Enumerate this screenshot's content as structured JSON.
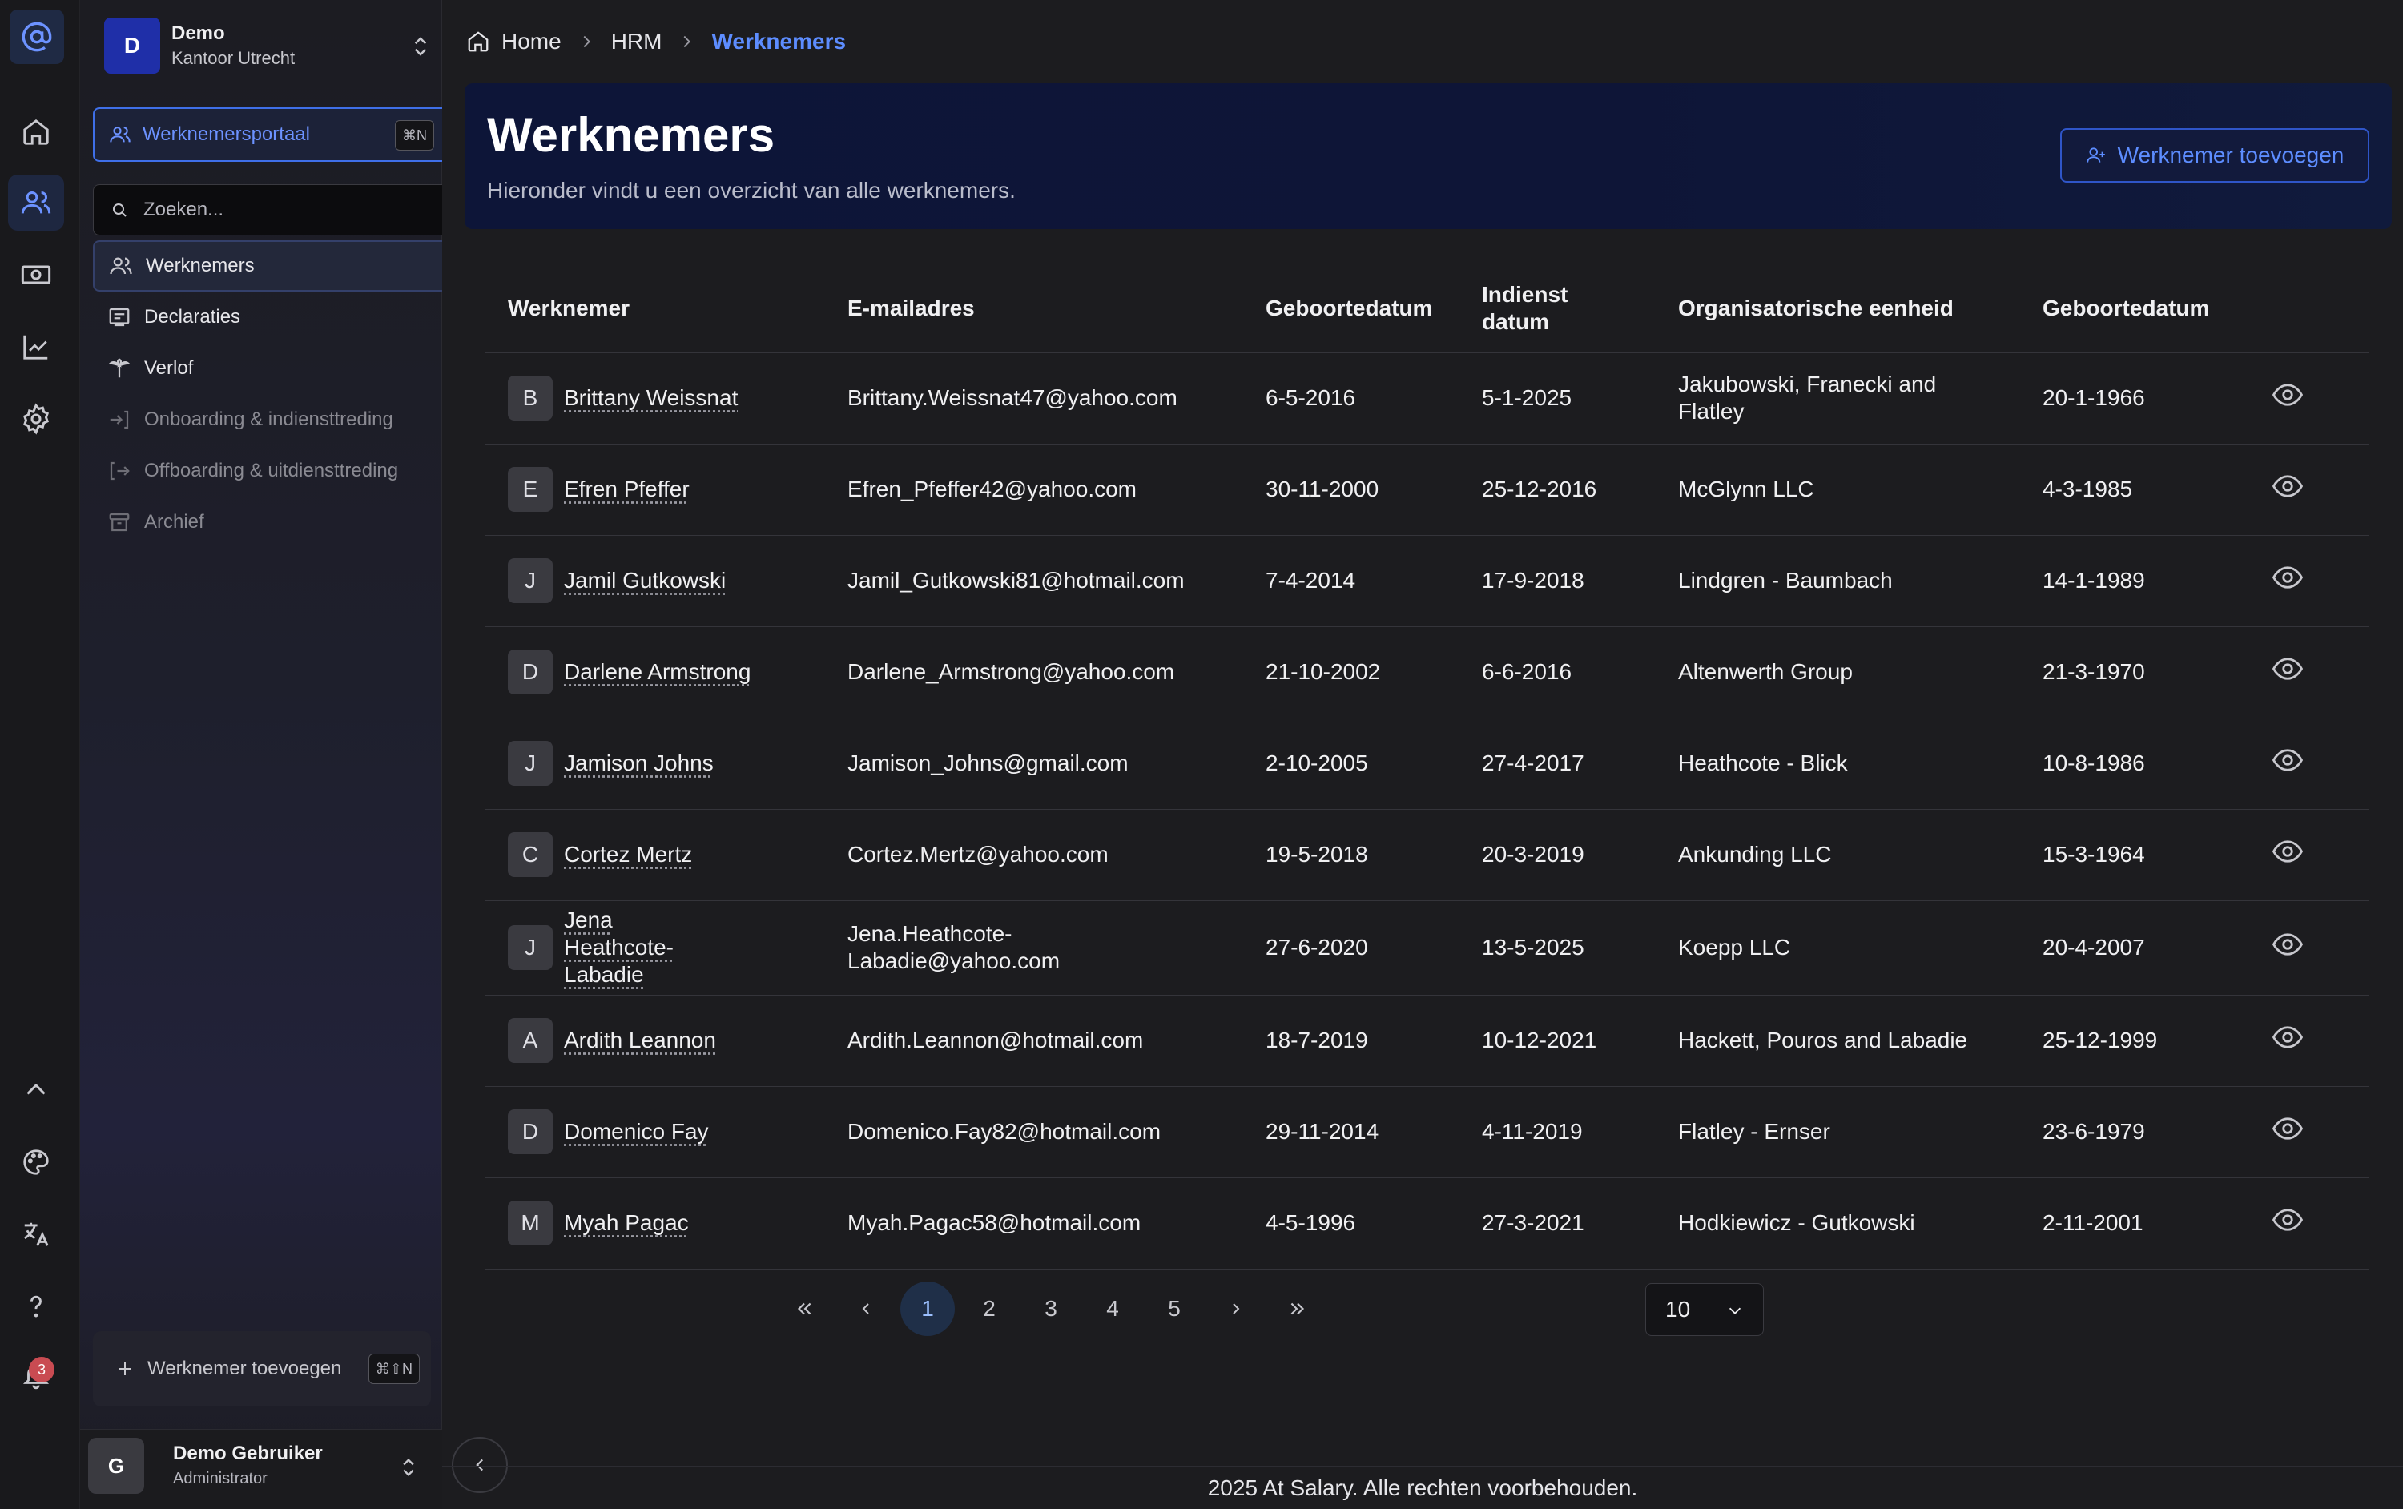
{
  "org": {
    "initial": "D",
    "name": "Demo",
    "location": "Kantoor Utrecht"
  },
  "portal": {
    "label": "Werknemersportaal",
    "shortcut": "⌘N"
  },
  "search": {
    "placeholder": "Zoeken..."
  },
  "nav": [
    {
      "label": "Werknemers",
      "icon": "users-icon",
      "state": "active"
    },
    {
      "label": "Declaraties",
      "icon": "receipt-icon",
      "state": "normal"
    },
    {
      "label": "Verlof",
      "icon": "palm-tree-icon",
      "state": "normal"
    },
    {
      "label": "Onboarding & indiensttreding",
      "icon": "login-icon",
      "state": "dim"
    },
    {
      "label": "Offboarding & uitdiensttreding",
      "icon": "logout-icon",
      "state": "dim"
    },
    {
      "label": "Archief",
      "icon": "archive-icon",
      "state": "dim"
    }
  ],
  "sidebar_add": {
    "label": "Werknemer toevoegen",
    "shortcut": "⌘⇧N"
  },
  "notifications": {
    "count": "3"
  },
  "user": {
    "initial": "G",
    "name": "Demo Gebruiker",
    "role": "Administrator"
  },
  "breadcrumb": {
    "home": "Home",
    "section": "HRM",
    "current": "Werknemers"
  },
  "header": {
    "title": "Werknemers",
    "subtitle": "Hieronder vindt u een overzicht van alle werknemers.",
    "add_button": "Werknemer toevoegen"
  },
  "table": {
    "columns": [
      "Werknemer",
      "E-mailadres",
      "Geboortedatum",
      "Indienst datum",
      "Organisatorische eenheid",
      "Geboortedatum"
    ],
    "rows": [
      {
        "initial": "B",
        "name": "Brittany Weissnat",
        "email": "Brittany.Weissnat47@yahoo.com",
        "birth": "6-5-2016",
        "start": "5-1-2025",
        "unit": "Jakubowski, Franecki and Flatley",
        "birth2": "20-1-1966"
      },
      {
        "initial": "E",
        "name": "Efren Pfeffer",
        "email": "Efren_Pfeffer42@yahoo.com",
        "birth": "30-11-2000",
        "start": "25-12-2016",
        "unit": "McGlynn LLC",
        "birth2": "4-3-1985"
      },
      {
        "initial": "J",
        "name": "Jamil Gutkowski",
        "email": "Jamil_Gutkowski81@hotmail.com",
        "birth": "7-4-2014",
        "start": "17-9-2018",
        "unit": "Lindgren - Baumbach",
        "birth2": "14-1-1989"
      },
      {
        "initial": "D",
        "name": "Darlene Armstrong",
        "email": "Darlene_Armstrong@yahoo.com",
        "birth": "21-10-2002",
        "start": "6-6-2016",
        "unit": "Altenwerth Group",
        "birth2": "21-3-1970"
      },
      {
        "initial": "J",
        "name": "Jamison Johns",
        "email": "Jamison_Johns@gmail.com",
        "birth": "2-10-2005",
        "start": "27-4-2017",
        "unit": "Heathcote - Blick",
        "birth2": "10-8-1986"
      },
      {
        "initial": "C",
        "name": "Cortez Mertz",
        "email": "Cortez.Mertz@yahoo.com",
        "birth": "19-5-2018",
        "start": "20-3-2019",
        "unit": "Ankunding LLC",
        "birth2": "15-3-1964"
      },
      {
        "initial": "J",
        "name": "Jena Heathcote-Labadie",
        "email": "Jena.Heathcote-Labadie@yahoo.com",
        "birth": "27-6-2020",
        "start": "13-5-2025",
        "unit": "Koepp LLC",
        "birth2": "20-4-2007"
      },
      {
        "initial": "A",
        "name": "Ardith Leannon",
        "email": "Ardith.Leannon@hotmail.com",
        "birth": "18-7-2019",
        "start": "10-12-2021",
        "unit": "Hackett, Pouros and Labadie",
        "birth2": "25-12-1999"
      },
      {
        "initial": "D",
        "name": "Domenico Fay",
        "email": "Domenico.Fay82@hotmail.com",
        "birth": "29-11-2014",
        "start": "4-11-2019",
        "unit": "Flatley - Ernser",
        "birth2": "23-6-1979"
      },
      {
        "initial": "M",
        "name": "Myah Pagac",
        "email": "Myah.Pagac58@hotmail.com",
        "birth": "4-5-1996",
        "start": "27-3-2021",
        "unit": "Hodkiewicz - Gutkowski",
        "birth2": "2-11-2001"
      }
    ]
  },
  "pagination": {
    "pages": [
      "1",
      "2",
      "3",
      "4",
      "5"
    ],
    "current": "1",
    "page_size": "10"
  },
  "footer": {
    "text": "2025 At Salary. Alle rechten voorbehouden."
  },
  "colors": {
    "accent": "#5d8dff",
    "hero_bg": "#0d1538",
    "badge": "#c94b52"
  }
}
